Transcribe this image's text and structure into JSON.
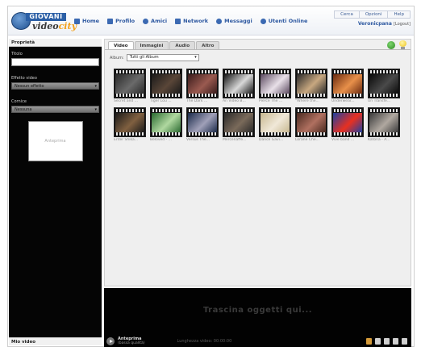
{
  "brand": {
    "top": "GIOVANI",
    "bottom_pre": "video",
    "bottom_hl": "city"
  },
  "nav": [
    {
      "label": "Home"
    },
    {
      "label": "Profilo"
    },
    {
      "label": "Amici"
    },
    {
      "label": "Network"
    },
    {
      "label": "Messaggi"
    },
    {
      "label": "Utenti Online"
    }
  ],
  "toplinks": [
    "Cerca",
    "Opzioni",
    "Help"
  ],
  "user": {
    "name": "Veronicpana",
    "logout": "[Logout]"
  },
  "left": {
    "title": "Proprietà",
    "title_label": "Titolo",
    "effect_label": "Effetto video",
    "effect_value": "Nessun effetto",
    "cornice_label": "Cornice",
    "cornice_value": "Nessuna",
    "preview": "Anteprima",
    "footer": "Mio video"
  },
  "tabs": [
    "Video",
    "Immagini",
    "Audio",
    "Altro"
  ],
  "album": {
    "label": "Album:",
    "value": "Tutti gli Album"
  },
  "clips": [
    {
      "caption": "Secret and ...",
      "colors": [
        "#2a2a2a",
        "#6a6a6a"
      ]
    },
    {
      "caption": "Tiger Lou ...",
      "colors": [
        "#1a1a1a",
        "#5a4638"
      ]
    },
    {
      "caption": "The Dark ...",
      "colors": [
        "#3a1c1c",
        "#9a5a50"
      ]
    },
    {
      "caption": "An Video B...",
      "colors": [
        "#151515",
        "#d8d8d8"
      ]
    },
    {
      "caption": "Pierce The ...",
      "colors": [
        "#5c4a60",
        "#e8e0e8"
      ]
    },
    {
      "caption": "\"Where the...",
      "colors": [
        "#2a2a2a",
        "#c8a880"
      ]
    },
    {
      "caption": "Underwear...",
      "colors": [
        "#6a2a10",
        "#e8904a"
      ]
    },
    {
      "caption": "Un Transfe...",
      "colors": [
        "#0a0a0a",
        "#4a4a4a"
      ]
    },
    {
      "caption": "Enter Shika...",
      "colors": [
        "#1a1a1a",
        "#806040"
      ]
    },
    {
      "caption": "Beloved - ...",
      "colors": [
        "#2a6a30",
        "#b0d8a0"
      ]
    },
    {
      "caption": "Versus The...",
      "colors": [
        "#1a2a4a",
        "#a0a0b8"
      ]
    },
    {
      "caption": "Mercenaffe...",
      "colors": [
        "#2a2a2a",
        "#7a6a5a"
      ]
    },
    {
      "caption": "Dance Gavi...",
      "colors": [
        "#c8b890",
        "#f0e8d8"
      ]
    },
    {
      "caption": "Lorane Che...",
      "colors": [
        "#4a2a20",
        "#b07060"
      ]
    },
    {
      "caption": "Vive band ...",
      "colors": [
        "#2040a0",
        "#e83020"
      ]
    },
    {
      "caption": "Katona - A...",
      "colors": [
        "#3a3a3a",
        "#b0a8a0"
      ]
    }
  ],
  "drop": {
    "text": "Trascina oggetti qui...",
    "preview_title": "Anteprima",
    "preview_sub": "(bassa qualità)",
    "length": "Lunghezza video: 00:00:00"
  }
}
